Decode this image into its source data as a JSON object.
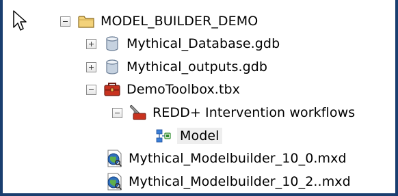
{
  "tree": {
    "root": {
      "label": "MODEL_BUILDER_DEMO",
      "state": "expanded"
    },
    "items": [
      {
        "label": "Mythical_Database.gdb",
        "state": "collapsed"
      },
      {
        "label": "Mythical_outputs.gdb",
        "state": "collapsed"
      },
      {
        "label": "DemoToolbox.tbx",
        "state": "expanded"
      },
      {
        "label": "REDD+ Intervention workflows",
        "state": "expanded"
      },
      {
        "label": "Model",
        "state": "selected"
      },
      {
        "label": "Mythical_Modelbuilder_10_0.mxd"
      },
      {
        "label": "Mythical_Modelbuilder_10_2..mxd"
      }
    ]
  },
  "icons": {
    "cursor": "mouse-pointer-icon",
    "folder": "folder-icon",
    "geodatabase": "geodatabase-icon",
    "toolbox": "toolbox-icon",
    "toolset": "toolset-icon",
    "model": "model-icon",
    "map_document": "map-document-icon"
  },
  "colors": {
    "frame_border": "#1a3e6f",
    "selected_background": "#eeeeee"
  }
}
